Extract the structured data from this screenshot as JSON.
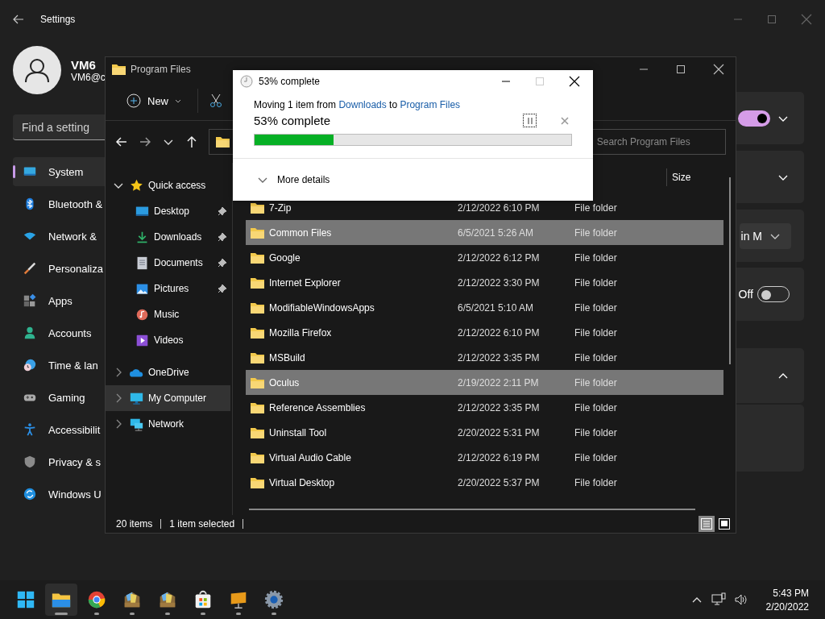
{
  "settings": {
    "title": "Settings",
    "user": {
      "name": "VM6",
      "email": "VM6@c"
    },
    "search": {
      "placeholder": "Find a setting"
    },
    "nav": [
      {
        "label": "System",
        "kind": "system",
        "selected": true
      },
      {
        "label": "Bluetooth &",
        "kind": "bluetooth",
        "selected": false
      },
      {
        "label": "Network &",
        "kind": "network",
        "selected": false
      },
      {
        "label": "Personaliza",
        "kind": "personalization",
        "selected": false
      },
      {
        "label": "Apps",
        "kind": "apps",
        "selected": false
      },
      {
        "label": "Accounts",
        "kind": "accounts",
        "selected": false
      },
      {
        "label": "Time & lan",
        "kind": "time",
        "selected": false
      },
      {
        "label": "Gaming",
        "kind": "gaming",
        "selected": false
      },
      {
        "label": "Accessibilit",
        "kind": "accessibility",
        "selected": false
      },
      {
        "label": "Privacy & s",
        "kind": "privacy",
        "selected": false
      },
      {
        "label": "Windows U",
        "kind": "update",
        "selected": false
      }
    ],
    "cards": [
      {
        "kind": "toggle-expander",
        "on": true,
        "expanded": false
      },
      {
        "kind": "expander",
        "expanded": false
      },
      {
        "kind": "dropdown",
        "value": "in M"
      },
      {
        "kind": "toggle",
        "on": false,
        "label": "Off"
      },
      {
        "kind": "expander",
        "expanded": true
      },
      {
        "kind": "panel"
      }
    ]
  },
  "explorer": {
    "title": "Program Files",
    "new_label": "New",
    "search": {
      "placeholder": "Search Program Files"
    },
    "tree": [
      {
        "label": "Quick access",
        "kind": "star",
        "expanded": true,
        "selected": false,
        "children": [
          {
            "label": "Desktop",
            "kind": "desktop",
            "pinned": true,
            "selected": false
          },
          {
            "label": "Downloads",
            "kind": "downloads",
            "pinned": true,
            "selected": false
          },
          {
            "label": "Documents",
            "kind": "documents",
            "pinned": true,
            "selected": false
          },
          {
            "label": "Pictures",
            "kind": "pictures",
            "pinned": true,
            "selected": false
          },
          {
            "label": "Music",
            "kind": "music",
            "pinned": false,
            "selected": false
          },
          {
            "label": "Videos",
            "kind": "videos",
            "pinned": false,
            "selected": false
          }
        ]
      },
      {
        "label": "OneDrive",
        "kind": "cloud",
        "expanded": false,
        "selected": false
      },
      {
        "label": "My Computer",
        "kind": "computer",
        "expanded": false,
        "selected": true
      },
      {
        "label": "Network",
        "kind": "network",
        "expanded": false,
        "selected": false
      }
    ],
    "columns": [
      {
        "label": "Size"
      }
    ],
    "rows": [
      {
        "name": "7-Zip",
        "date": "2/12/2022 6:10 PM",
        "type": "File folder",
        "selected": false
      },
      {
        "name": "Common Files",
        "date": "6/5/2021 5:26 AM",
        "type": "File folder",
        "selected": true
      },
      {
        "name": "Google",
        "date": "2/12/2022 6:12 PM",
        "type": "File folder",
        "selected": false
      },
      {
        "name": "Internet Explorer",
        "date": "2/12/2022 3:30 PM",
        "type": "File folder",
        "selected": false
      },
      {
        "name": "ModifiableWindowsApps",
        "date": "6/5/2021 5:10 AM",
        "type": "File folder",
        "selected": false
      },
      {
        "name": "Mozilla Firefox",
        "date": "2/12/2022 6:10 PM",
        "type": "File folder",
        "selected": false
      },
      {
        "name": "MSBuild",
        "date": "2/12/2022 3:35 PM",
        "type": "File folder",
        "selected": false
      },
      {
        "name": "Oculus",
        "date": "2/19/2022 2:11 PM",
        "type": "File folder",
        "selected": true
      },
      {
        "name": "Reference Assemblies",
        "date": "2/12/2022 3:35 PM",
        "type": "File folder",
        "selected": false
      },
      {
        "name": "Uninstall Tool",
        "date": "2/20/2022 5:31 PM",
        "type": "File folder",
        "selected": false
      },
      {
        "name": "Virtual Audio Cable",
        "date": "2/12/2022 6:19 PM",
        "type": "File folder",
        "selected": false
      },
      {
        "name": "Virtual Desktop",
        "date": "2/20/2022 5:37 PM",
        "type": "File folder",
        "selected": false
      }
    ],
    "status": {
      "count": "20 items",
      "selection": "1 item selected"
    },
    "views": [
      {
        "kind": "details",
        "selected": true
      },
      {
        "kind": "tiles",
        "selected": false
      }
    ]
  },
  "dialog": {
    "title": "53% complete",
    "message": [
      {
        "kind": "text",
        "text": "Moving 1 item from "
      },
      {
        "kind": "link",
        "text": "Downloads"
      },
      {
        "kind": "text",
        "text": " to "
      },
      {
        "kind": "link",
        "text": "Program Files"
      }
    ],
    "status": "53% complete",
    "level": 0.25,
    "more": "More details"
  },
  "taskbar": {
    "apps": [
      {
        "kind": "start",
        "running": false,
        "active": false
      },
      {
        "kind": "explorer",
        "running": true,
        "active": true
      },
      {
        "kind": "browser",
        "running": true,
        "active": false
      },
      {
        "kind": "package",
        "running": true,
        "active": false
      },
      {
        "kind": "package",
        "running": true,
        "active": false
      },
      {
        "kind": "store",
        "running": true,
        "active": false
      },
      {
        "kind": "easel",
        "running": true,
        "active": false
      },
      {
        "kind": "settings",
        "running": true,
        "active": false
      }
    ],
    "time": "5:43 PM",
    "date": "2/20/2022"
  }
}
